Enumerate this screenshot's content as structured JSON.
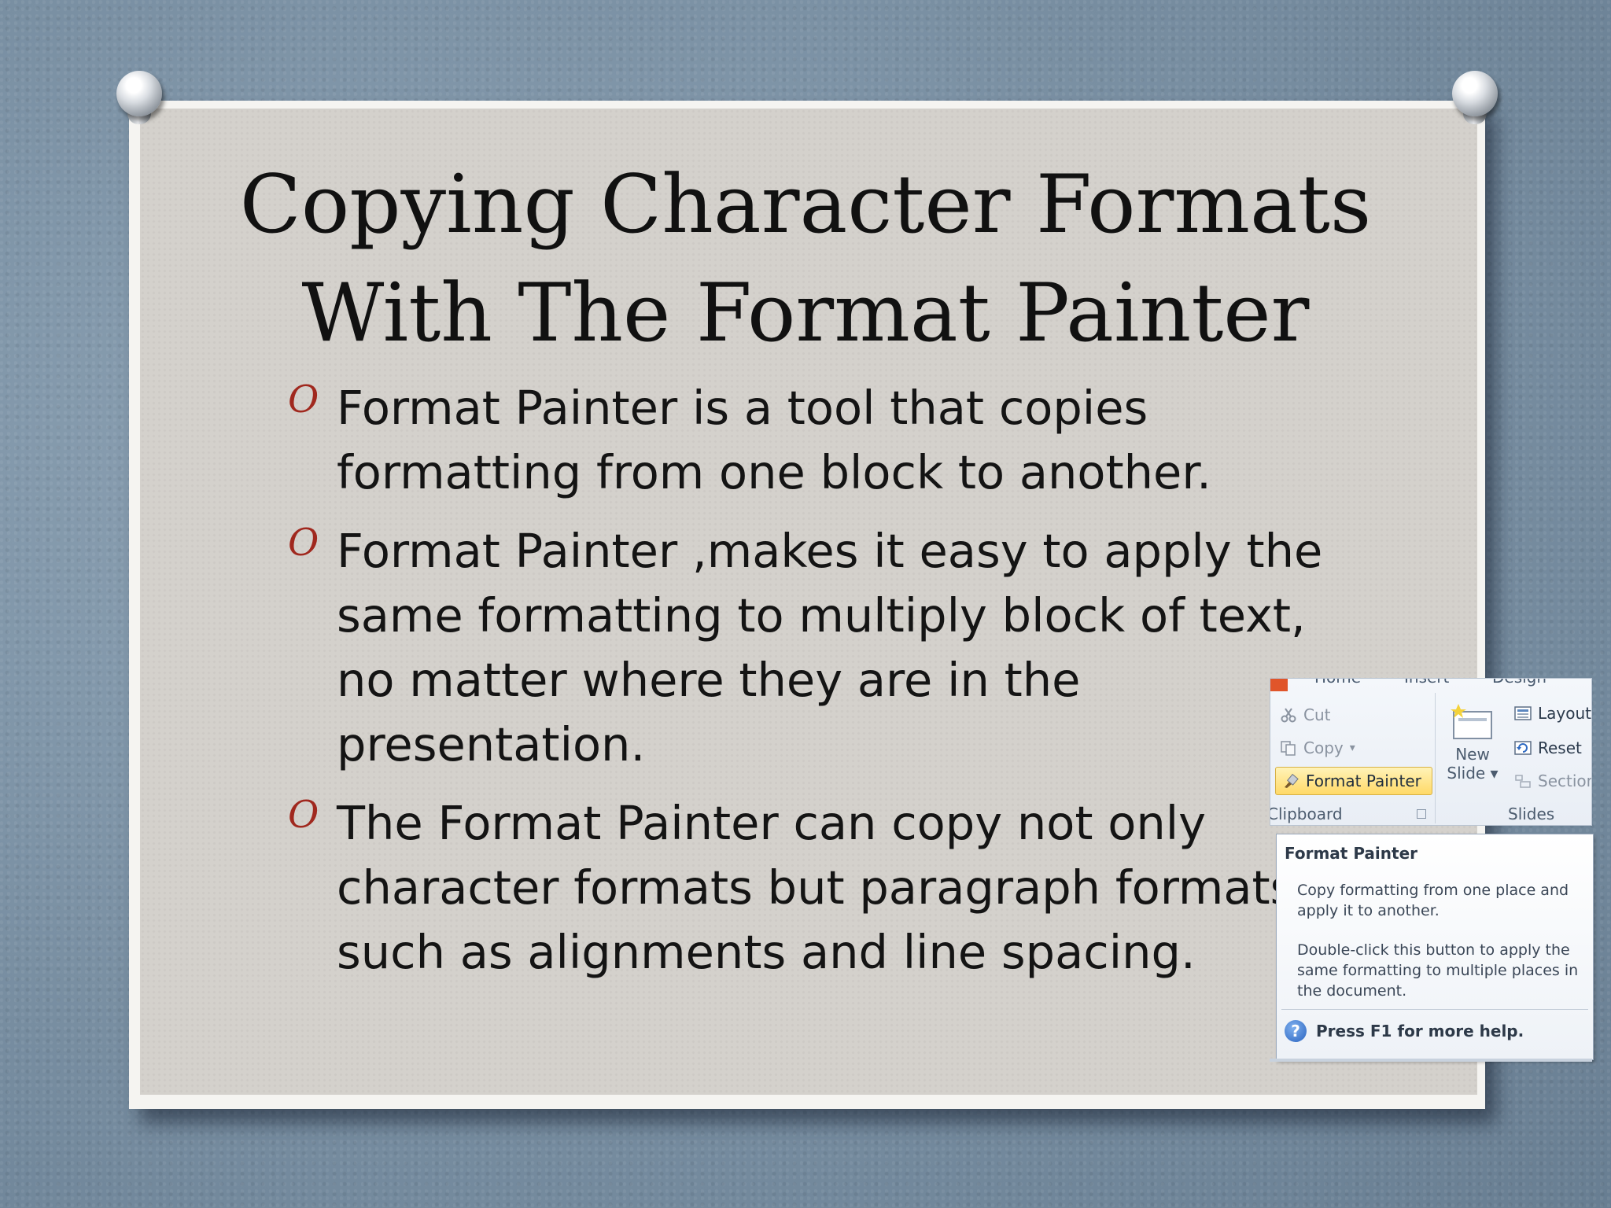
{
  "slide": {
    "title_line1": "Copying Character Formats",
    "title_line2": "With The Format Painter",
    "bullet_marker": "O",
    "bullets": [
      "Format Painter is a tool that copies formatting from one block to another.",
      "Format Painter ,makes it easy to apply the same formatting to multiply block of text, no matter where they are in the presentation.",
      "The Format Painter can copy not only character formats but paragraph formats such as alignments and line spacing."
    ]
  },
  "ribbon": {
    "tabs": [
      "Home",
      "Insert",
      "Design"
    ],
    "clipboard": {
      "cut_label": "Cut",
      "copy_label": "Copy",
      "copy_arrow": "▾",
      "format_painter_label": "Format Painter",
      "group_label": "Clipboard"
    },
    "slides": {
      "new_slide_line1": "New",
      "new_slide_line2": "Slide ▾",
      "layout_label": "Layout",
      "reset_label": "Reset",
      "section_label": "Section",
      "group_label": "Slides"
    }
  },
  "tooltip": {
    "title": "Format Painter",
    "paragraph1": "Copy formatting from one place and apply it to another.",
    "paragraph2": "Double-click this button to apply the same formatting to multiple places in the document.",
    "help_icon_glyph": "?",
    "help_text": "Press F1 for more help."
  },
  "colors": {
    "bullet_accent": "#a0281e",
    "background": "#7d93a6",
    "paper": "#d4d1cc",
    "format_painter_highlight": "#ffd967"
  },
  "icons": {
    "pins": "push-pin-icon",
    "cut": "scissors-icon",
    "copy": "copy-icon",
    "format_painter": "paintbrush-icon",
    "new_slide": "new-slide-icon",
    "layout": "layout-icon",
    "reset": "reset-icon",
    "section": "section-icon",
    "help": "help-icon"
  }
}
